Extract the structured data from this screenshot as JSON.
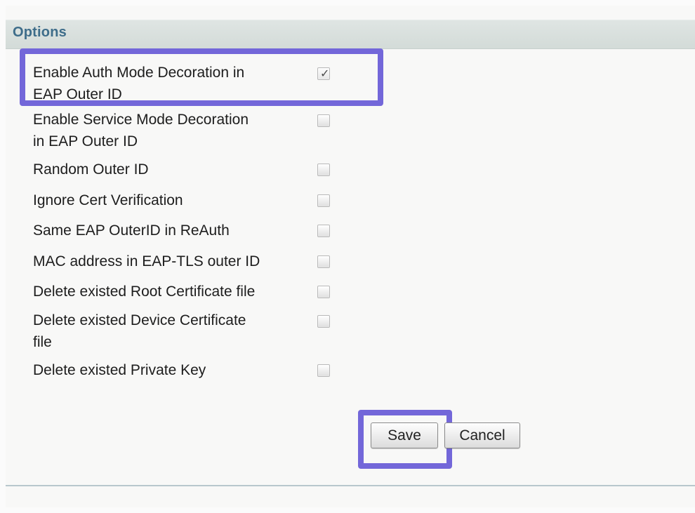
{
  "section": {
    "title": "Options"
  },
  "options": [
    {
      "label_line_1": "Enable Auth Mode Decoration in",
      "label_line_2": "EAP Outer ID",
      "checked": true
    },
    {
      "label_line_1": "Enable Service Mode Decoration",
      "label_line_2": "in EAP Outer ID",
      "checked": false
    },
    {
      "label": "Random Outer ID",
      "checked": false
    },
    {
      "label": "Ignore Cert Verification",
      "checked": false
    },
    {
      "label": "Same EAP OuterID in ReAuth",
      "checked": false
    },
    {
      "label": "MAC address in EAP-TLS outer ID",
      "checked": false
    },
    {
      "label": "Delete existed Root Certificate file",
      "checked": false
    },
    {
      "label_line_1": "Delete existed Device Certificate",
      "label_line_2": "file",
      "checked": false
    },
    {
      "label": "Delete existed Private Key",
      "checked": false
    }
  ],
  "buttons": {
    "save_label": "Save",
    "cancel_label": "Cancel"
  },
  "icons": {
    "check": "check-mark-icon"
  },
  "colors": {
    "highlight": "#7367d9",
    "section_title": "#3e6d8a"
  }
}
